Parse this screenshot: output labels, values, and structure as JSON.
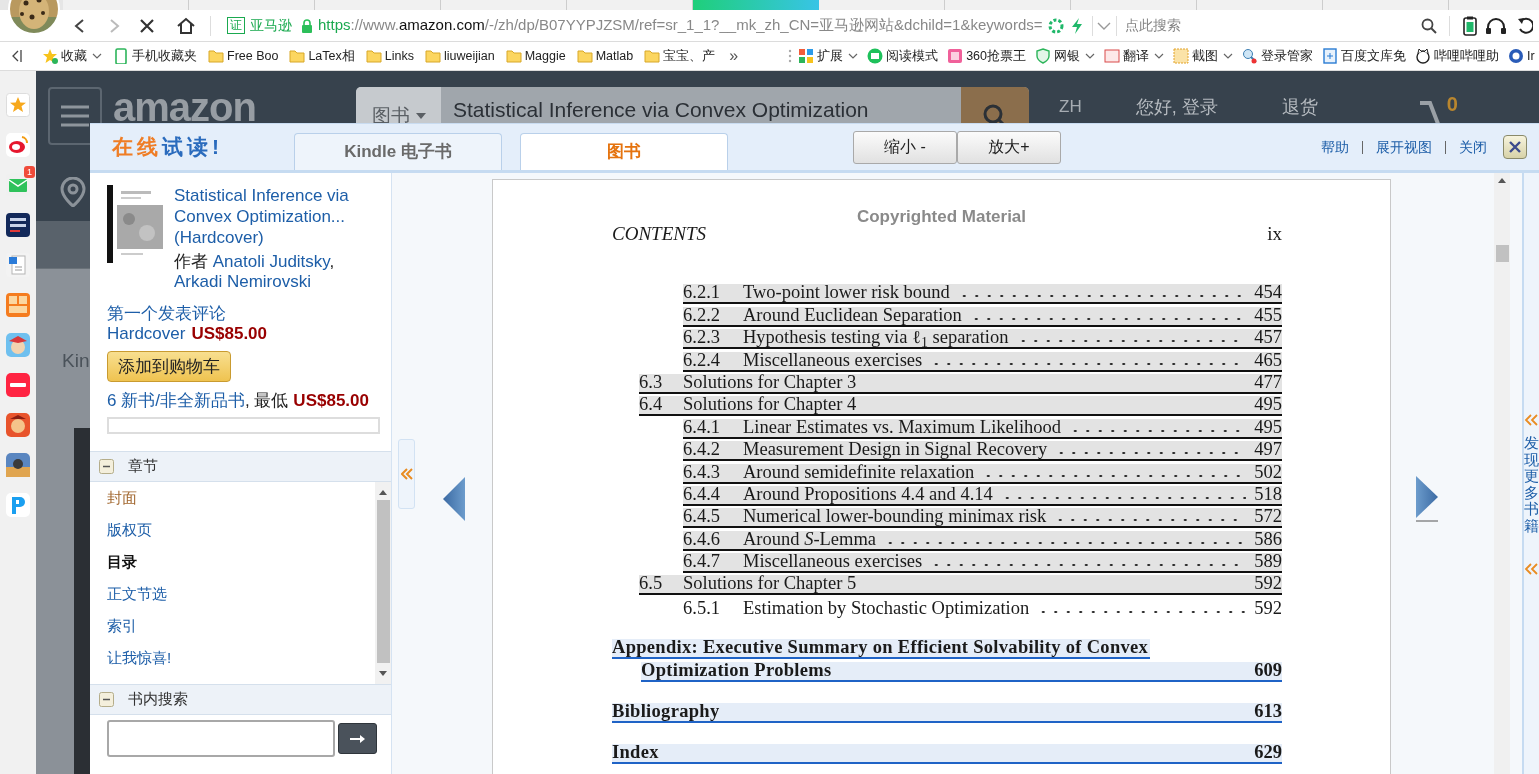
{
  "browser": {
    "tabs": [
      {
        "selected": false
      },
      {
        "selected": false
      },
      {
        "selected": false
      },
      {
        "selected": false
      },
      {
        "selected": false
      },
      {
        "selected": true
      },
      {
        "selected": false
      },
      {
        "selected": false
      },
      {
        "selected": false
      },
      {
        "selected": false
      },
      {
        "selected": false
      },
      {
        "selected": false
      }
    ],
    "site_badge": {
      "icon_text": "证",
      "label": "亚马逊"
    },
    "url": {
      "scheme": "https",
      "prefix": "://www.",
      "host": "amazon.com",
      "path": "/-/zh/dp/B07YYPJZSM/ref=sr_1_1?__mk_zh_CN=亚马逊网站&dchild=1&keywords="
    },
    "search": {
      "placeholder": "点此搜索"
    }
  },
  "bookmarks": {
    "left": [
      {
        "kind": "star",
        "label": "收藏",
        "menu": true
      },
      {
        "kind": "phone",
        "label": "手机收藏夹",
        "menu": false
      },
      {
        "kind": "folder",
        "label": "Free Boo",
        "menu": false
      },
      {
        "kind": "folder",
        "label": "LaTex相",
        "menu": false
      },
      {
        "kind": "folder",
        "label": "Links",
        "menu": false
      },
      {
        "kind": "folder",
        "label": "liuweijian",
        "menu": false
      },
      {
        "kind": "folder",
        "label": "Maggie",
        "menu": false
      },
      {
        "kind": "folder",
        "label": "Matlab",
        "menu": false
      },
      {
        "kind": "folder",
        "label": "宝宝、产",
        "menu": false
      }
    ],
    "more": "»",
    "right": [
      {
        "kind": "apps",
        "label": "扩展",
        "menu": true
      },
      {
        "kind": "reader",
        "label": "阅读模式",
        "menu": false
      },
      {
        "kind": "ticket",
        "label": "360抢票王",
        "menu": false
      },
      {
        "kind": "shield",
        "label": "网银",
        "menu": true
      },
      {
        "kind": "translate",
        "label": "翻译",
        "menu": true
      },
      {
        "kind": "crop",
        "label": "截图",
        "menu": true
      },
      {
        "kind": "key",
        "label": "登录管家",
        "menu": false
      },
      {
        "kind": "doc",
        "label": "百度文库免",
        "menu": false
      },
      {
        "kind": "cat",
        "label": "哔哩哔哩助",
        "menu": false
      },
      {
        "kind": "globe",
        "label": "Ir",
        "menu": false
      }
    ]
  },
  "side_apps": [
    {
      "kind": "star"
    },
    {
      "kind": "weibo"
    },
    {
      "kind": "mail",
      "badge": "1"
    },
    {
      "kind": "school"
    },
    {
      "kind": "word"
    },
    {
      "kind": "novel"
    },
    {
      "kind": "game"
    },
    {
      "kind": "notes"
    },
    {
      "kind": "warrior"
    },
    {
      "kind": "shooter"
    },
    {
      "kind": "pay"
    }
  ],
  "amazon": {
    "logo": "amazon",
    "search_category": "图书",
    "search_text": "Statistical Inference via Convex Optimization",
    "language": "ZH",
    "greeting": "您好, 登录",
    "returns": "退货",
    "cart_count": "0",
    "side_text": "Kin"
  },
  "reader": {
    "logo": [
      "在线",
      "试读!"
    ],
    "tabs": [
      {
        "label": "Kindle 电子书",
        "selected": false
      },
      {
        "label": "图书",
        "selected": true
      }
    ],
    "zoom_buttons": [
      "缩小 -",
      "放大+"
    ],
    "links": [
      "帮助",
      "展开视图",
      "关闭"
    ],
    "book": {
      "title": "Statistical Inference via Convex Optimization... (Hardcover)",
      "author_prefix": "作者",
      "authors": [
        "Anatoli Juditsky",
        "Arkadi Nemirovski"
      ],
      "author_separator": ",",
      "review_link": "第一个发表评论",
      "binding": "Hardcover",
      "price": "US$85.00",
      "cart_button": "添加到购物车",
      "offers_link": "6 新书/非全新品书",
      "offers_sep": ", 最低",
      "offers_price": "US$85.00"
    },
    "chapters": {
      "title": "章节",
      "expanded": true,
      "items": [
        {
          "label": "封面",
          "selected": false,
          "visited": true
        },
        {
          "label": "版权页",
          "selected": false,
          "visited": false
        },
        {
          "label": "目录",
          "selected": true,
          "visited": false
        },
        {
          "label": "正文节选",
          "selected": false,
          "visited": false
        },
        {
          "label": "索引",
          "selected": false,
          "visited": false
        },
        {
          "label": "让我惊喜!",
          "selected": false,
          "visited": false
        }
      ]
    },
    "search": {
      "title": "书内搜索",
      "expanded": true
    },
    "page": {
      "header": "Copyrighted Material",
      "running_head": "CONTENTS",
      "page_number": "ix",
      "toc": [
        {
          "children": [
            {
              "children": [
                {
                  "number": "6.2.1",
                  "title": "Two-point lower risk bound",
                  "page": "454",
                  "highlighted": true,
                  "color": "#e3e3e3"
                },
                {
                  "number": "6.2.2",
                  "title": "Around Euclidean Separation",
                  "page": "455",
                  "highlighted": true,
                  "color": "#e3e3e3"
                },
                {
                  "number": "6.2.3",
                  "title": "Hypothesis testing via ℓ$_{1}$ separation",
                  "page": "457",
                  "highlighted": true,
                  "color": "#e3e3e3"
                },
                {
                  "number": "6.2.4",
                  "title": "Miscellaneous exercises",
                  "page": "465",
                  "highlighted": true,
                  "color": "#e3e3e3"
                }
              ]
            },
            {
              "number": "6.3",
              "title": "Solutions for Chapter 3",
              "page": "477",
              "highlighted": true,
              "color": "#e3e3e3"
            },
            {
              "number": "6.4",
              "title": "Solutions for Chapter 4",
              "page": "495",
              "highlighted": true,
              "color": "#e3e3e3",
              "children": [
                {
                  "number": "6.4.1",
                  "title": "Linear Estimates vs. Maximum Likelihood",
                  "page": "495",
                  "highlighted": true,
                  "color": "#e3e3e3"
                },
                {
                  "number": "6.4.2",
                  "title": "Measurement Design in Signal Recovery",
                  "page": "497",
                  "highlighted": true,
                  "color": "#e3e3e3"
                },
                {
                  "number": "6.4.3",
                  "title": "Around semidefinite relaxation",
                  "page": "502",
                  "highlighted": true,
                  "color": "#e3e3e3"
                },
                {
                  "number": "6.4.4",
                  "title": "Around Propositions 4.4 and 4.14",
                  "page": "518",
                  "highlighted": true,
                  "color": "#e3e3e3"
                },
                {
                  "number": "6.4.5",
                  "title": "Numerical lower-bounding minimax risk",
                  "page": "572",
                  "highlighted": true,
                  "color": "#e3e3e3"
                },
                {
                  "number": "6.4.6",
                  "title": "Around *S*-Lemma",
                  "page": "586",
                  "highlighted": true,
                  "color": "#e3e3e3"
                },
                {
                  "number": "6.4.7",
                  "title": "Miscellaneous exercises",
                  "page": "589",
                  "highlighted": true,
                  "color": "#e3e3e3"
                }
              ]
            },
            {
              "number": "6.5",
              "title": "Solutions for Chapter 5",
              "page": "592",
              "highlighted": true,
              "color": "#e3e3e3",
              "children": [
                {
                  "number": "6.5.1",
                  "title": "Estimation by Stochastic Optimization",
                  "page": "592",
                  "highlighted": false
                }
              ]
            }
          ]
        },
        {
          "title_lines": [
            "Appendix: Executive Summary on Efficient Solvability of Convex",
            "Optimization Problems"
          ],
          "page": "609",
          "highlighted": true,
          "color": "#e5edf8"
        },
        {
          "title": "Bibliography",
          "page": "613",
          "highlighted": true,
          "color": "#e5edf8"
        },
        {
          "title": "Index",
          "page": "629",
          "highlighted": true,
          "color": "#e5edf8"
        }
      ]
    },
    "more_books": "发现更多书籍"
  }
}
